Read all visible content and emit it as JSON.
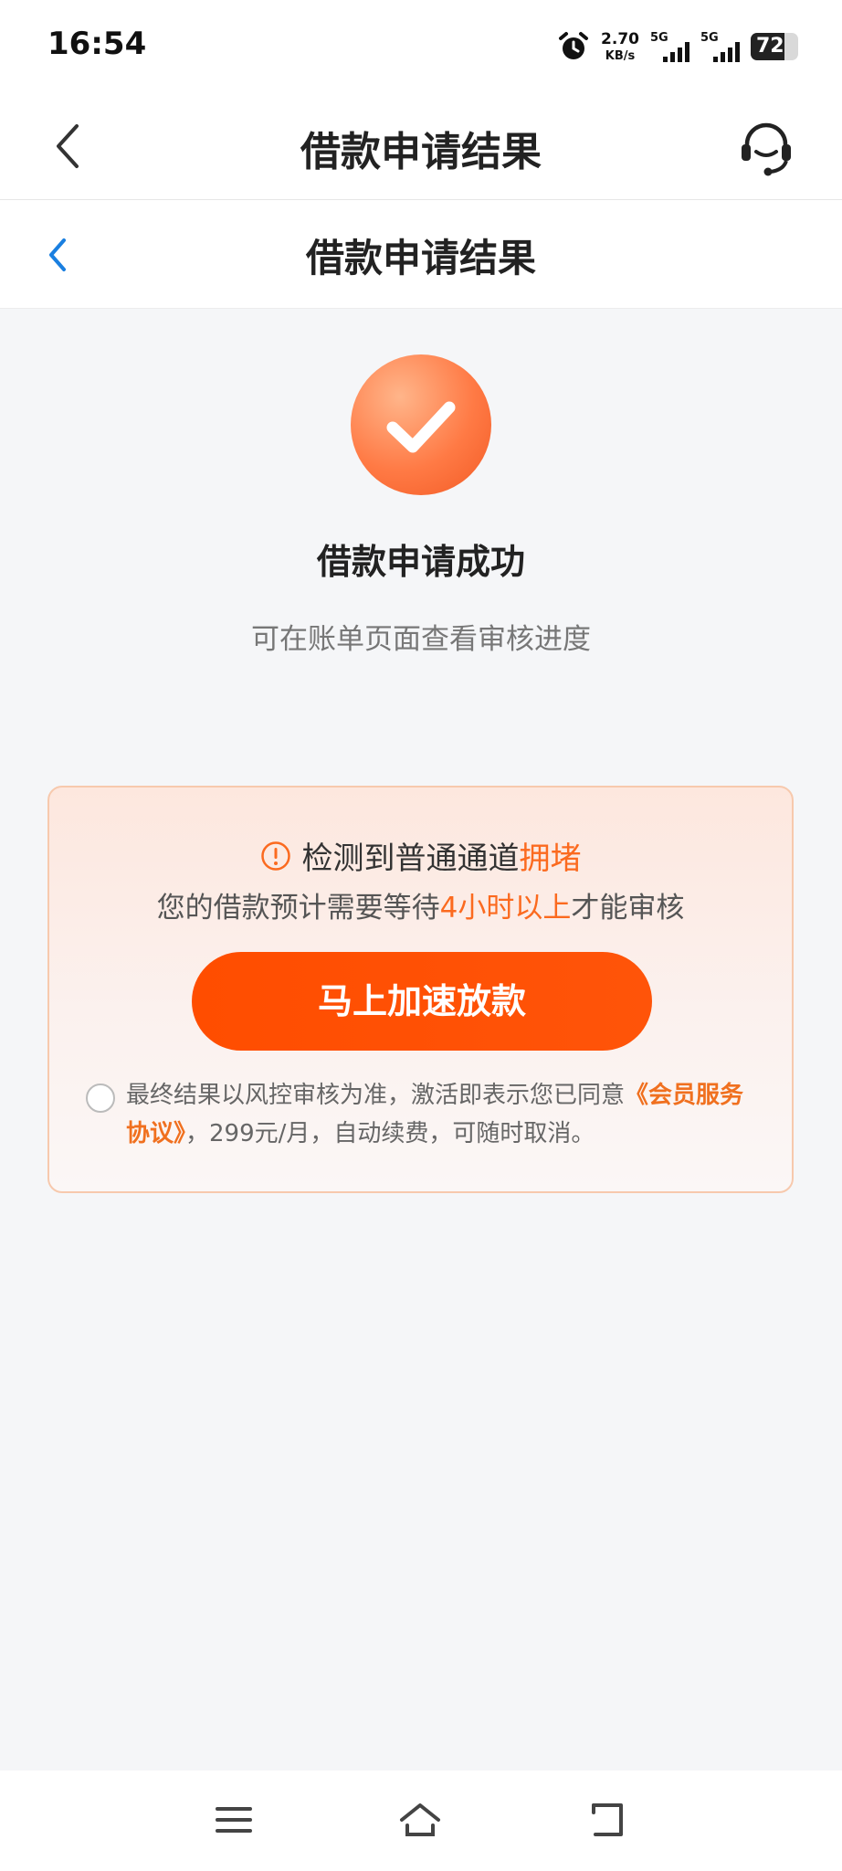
{
  "status_bar": {
    "time": "16:54",
    "net_speed_value": "2.70",
    "net_speed_unit": "KB/s",
    "network_1": "5G",
    "network_2": "5G",
    "battery": "72",
    "battery_level": 0.72
  },
  "header": {
    "title": "借款申请结果"
  },
  "sub_header": {
    "title": "借款申请结果"
  },
  "result": {
    "title": "借款申请成功",
    "subtitle": "可在账单页面查看审核进度"
  },
  "alert_card": {
    "warning_prefix": "检测到普通通道",
    "warning_highlight": "拥堵",
    "wait_prefix": "您的借款预计需要等待",
    "wait_highlight": "4小时以上",
    "wait_suffix": "才能审核",
    "button_label": "马上加速放款",
    "agreement_text": "最终结果以风控审核为准，激活即表示您已同意",
    "agreement_link": "《会员服务协议》",
    "agreement_suffix": "，299元/月，自动续费，可随时取消。"
  },
  "colors": {
    "accent": "#ff5000",
    "highlight": "#fb6a1f",
    "success_circle": "#ff7a45",
    "link_blue": "#1a7fe0"
  }
}
